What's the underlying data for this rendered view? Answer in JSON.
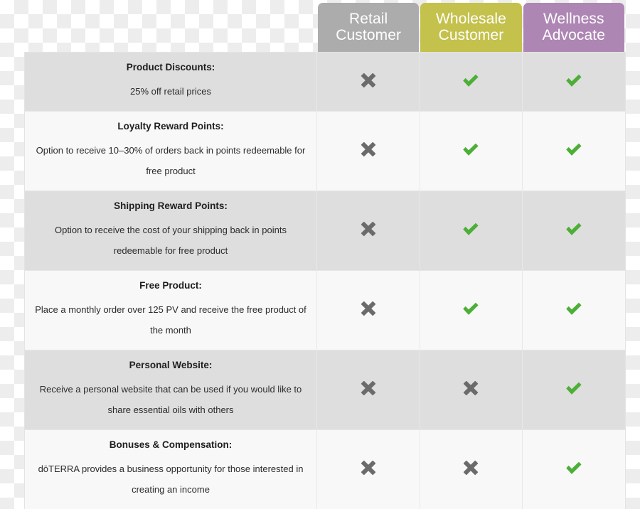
{
  "columns": [
    {
      "id": "retail",
      "label_line1": "Retail",
      "label_line2": "Customer",
      "color": "#acacac"
    },
    {
      "id": "wholesale",
      "label_line1": "Wholesale",
      "label_line2": "Customer",
      "color": "#c4c14c"
    },
    {
      "id": "wellness",
      "label_line1": "Wellness",
      "label_line2": "Advocate",
      "color": "#ae86b4"
    }
  ],
  "icons": {
    "check": "check-icon",
    "cross": "cross-icon",
    "check_color": "#4caf36",
    "cross_color": "#6b6b6b"
  },
  "rows": [
    {
      "title": "Product Discounts:",
      "body": "25% off retail prices",
      "marks": [
        "cross",
        "check",
        "check"
      ]
    },
    {
      "title": "Loyalty Reward Points:",
      "body": "Option to receive 10–30% of orders back in points redeemable for free product",
      "marks": [
        "cross",
        "check",
        "check"
      ]
    },
    {
      "title": "Shipping Reward Points:",
      "body": "Option to receive the cost of your shipping back in points redeemable for free product",
      "marks": [
        "cross",
        "check",
        "check"
      ]
    },
    {
      "title": "Free Product:",
      "body": "Place a monthly order over 125 PV and receive the free product of the month",
      "marks": [
        "cross",
        "check",
        "check"
      ]
    },
    {
      "title": "Personal Website:",
      "body": "Receive a personal website that can be used if you would like to share essential oils with others",
      "marks": [
        "cross",
        "cross",
        "check"
      ]
    },
    {
      "title": "Bonuses & Compensation:",
      "body": "dōTERRA provides a business opportunity for those interested in creating an income",
      "marks": [
        "cross",
        "cross",
        "check"
      ]
    }
  ]
}
